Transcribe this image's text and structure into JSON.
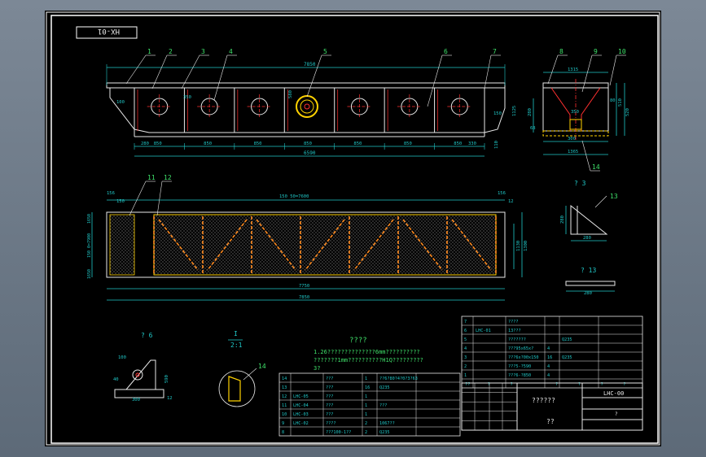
{
  "drawing_code": "HX-01",
  "title_block": {
    "drawing_number": "LHC-00",
    "title_cell": "??????",
    "sub_cell": "??",
    "scale_label": "?"
  },
  "views": {
    "front": {
      "callouts": [
        "1",
        "2",
        "3",
        "4",
        "5",
        "6",
        "7"
      ],
      "overall_width_top": "7850",
      "bays": [
        "850",
        "850",
        "850",
        "850",
        "850",
        "850",
        "850"
      ],
      "end_left": "280",
      "end_right": "330",
      "overall_bottom": "6590",
      "dims_small": [
        "350",
        "100",
        "150",
        "1125",
        "110",
        "650",
        "580",
        "90"
      ]
    },
    "side": {
      "callouts": [
        "8",
        "9",
        "10",
        "14"
      ],
      "top_dim": "1315",
      "bottom_dim_a": "300",
      "bottom_dim_b": "1365",
      "right_dims": [
        "510",
        "520"
      ],
      "inner": [
        "280",
        "350",
        "80",
        "68"
      ]
    },
    "plan": {
      "callouts": [
        "11",
        "12"
      ],
      "top_dim": "150 50=7600",
      "top_left_dims": [
        "156",
        "150"
      ],
      "top_right_dims": [
        "156",
        "12"
      ],
      "left_dims": [
        "1650",
        "150 0=7900",
        "1650"
      ],
      "right_dims": [
        "1130",
        "1300"
      ],
      "bottom_dims": [
        "7750",
        "7850"
      ]
    },
    "detail_a": {
      "label": "? 3",
      "callout": "13",
      "dims": [
        "280",
        "280"
      ]
    },
    "detail_b": {
      "label": "? 13",
      "dim": "280"
    },
    "detail_c": {
      "label": "? 6",
      "dims": [
        "100",
        "40",
        "300",
        "590",
        "12"
      ]
    },
    "detail_d": {
      "label": "I",
      "scale": "2:1",
      "callout": "14"
    }
  },
  "notes": {
    "heading": "????",
    "lines": [
      "1.26??????????????6mm??????????",
      "???????1mm??????????H1Q?????????",
      "3?"
    ]
  },
  "parts_right": {
    "rows": [
      {
        "no": "7",
        "code": "",
        "name": "????",
        "qty": "",
        "mat": ""
      },
      {
        "no": "6",
        "code": "LHC-01",
        "name": "13???",
        "qty": "",
        "mat": ""
      },
      {
        "no": "5",
        "code": "",
        "name": "???????",
        "qty": "",
        "mat": "Q235"
      },
      {
        "no": "4",
        "code": "",
        "name": "???95x65x?",
        "qty": "4",
        "mat": ""
      },
      {
        "no": "3",
        "code": "",
        "name": "???6x?00x150",
        "qty": "16",
        "mat": "Q235"
      },
      {
        "no": "2",
        "code": "",
        "name": "???5-?590",
        "qty": "4",
        "mat": ""
      },
      {
        "no": "1",
        "code": "",
        "name": "???6-?850",
        "qty": "4",
        "mat": ""
      }
    ],
    "header": [
      "??",
      "?",
      "?",
      "",
      "?",
      "?",
      "?",
      "?"
    ]
  },
  "parts_left": {
    "rows": [
      {
        "no": "14",
        "code": "",
        "name": "???",
        "qty": "1",
        "mat": "??6?80?4?0?3?63"
      },
      {
        "no": "13",
        "code": "",
        "name": "???",
        "qty": "16",
        "mat": "Q235"
      },
      {
        "no": "12",
        "code": "LHC-05",
        "name": "???",
        "qty": "1",
        "mat": ""
      },
      {
        "no": "11",
        "code": "LHC-04",
        "name": "???",
        "qty": "1",
        "mat": "???"
      },
      {
        "no": "10",
        "code": "LHC-03",
        "name": "???",
        "qty": "1",
        "mat": ""
      },
      {
        "no": "9",
        "code": "LHC-02",
        "name": "????",
        "qty": "2",
        "mat": "1067??"
      },
      {
        "no": "8",
        "code": "",
        "name": "???100-1??",
        "qty": "2",
        "mat": "Q235"
      }
    ]
  },
  "colors": {
    "frame": "#ffffff",
    "steel": "#e8e8e8",
    "dim": "#20c8c8",
    "hidden": "#ff3030",
    "mesh": "#ffd200",
    "weld": "#ff8a1e",
    "text": "#3fe06a",
    "bg": "#000000"
  }
}
